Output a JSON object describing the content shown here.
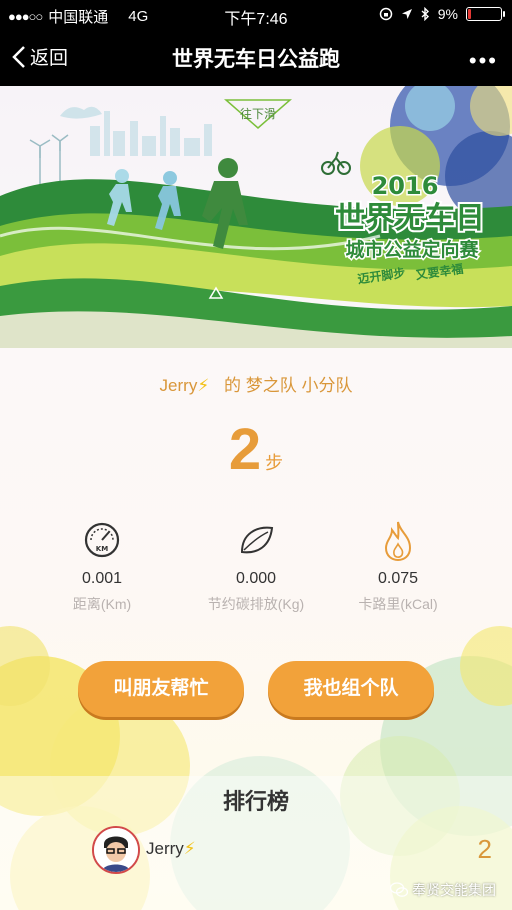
{
  "status_bar": {
    "signal": "●●●○○",
    "carrier": "中国联通",
    "network": "4G",
    "time": "下午7:46",
    "battery_percent": "9%",
    "battery_level": 0.09
  },
  "nav": {
    "back_label": "返回",
    "title": "世界无车日公益跑",
    "more": "•••"
  },
  "banner": {
    "scroll_hint": "往下滑",
    "year": "2016",
    "event_title": "世界无车日",
    "event_subtitle": "城市公益定向赛",
    "slogan_left": "迈开脚步",
    "slogan_right": "又要幸福"
  },
  "team": {
    "owner": "Jerry",
    "bolt": "⚡",
    "mid_text": "的 梦之队 小分队"
  },
  "steps": {
    "value": "2",
    "unit": "步"
  },
  "stats": [
    {
      "value": "0.001",
      "label": "距离(Km)",
      "icon": "speedometer-icon",
      "icon_text": "KM"
    },
    {
      "value": "0.000",
      "label": "节约碳排放(Kg)",
      "icon": "leaf-icon"
    },
    {
      "value": "0.075",
      "label": "卡路里(kCal)",
      "icon": "flame-icon"
    }
  ],
  "buttons": {
    "ask_friends": "叫朋友帮忙",
    "form_team": "我也组个队"
  },
  "ranking": {
    "title": "排行榜",
    "rows": [
      {
        "name": "Jerry",
        "bolt": "⚡",
        "steps": "2"
      }
    ]
  },
  "watermark": {
    "text": "奉贤交能集团"
  },
  "colors": {
    "accent": "#f2a23a",
    "green": "#2e8b3a",
    "title_text": "#e79c3a"
  }
}
